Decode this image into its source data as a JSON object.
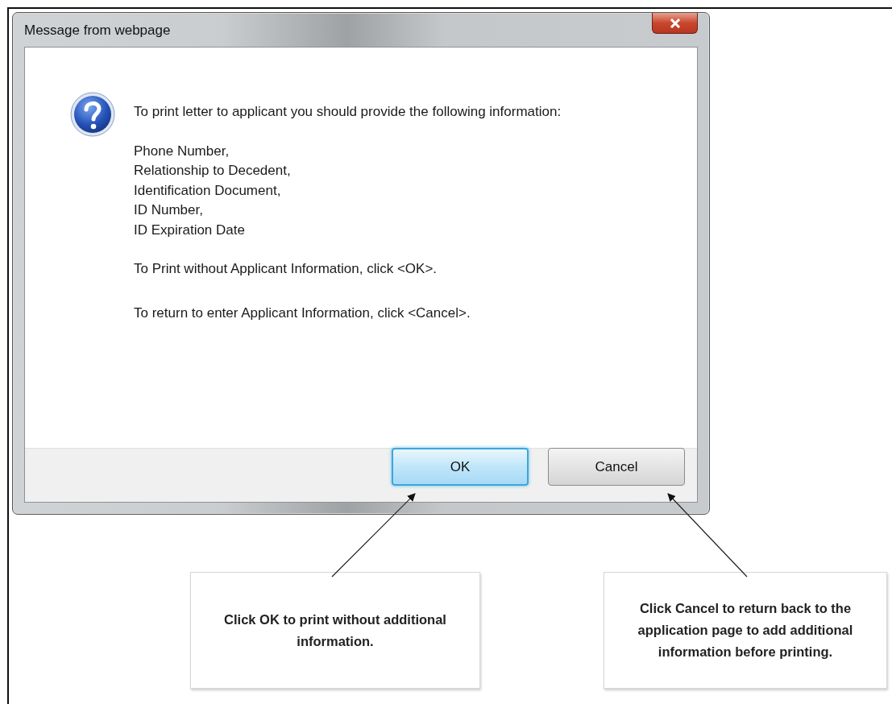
{
  "window": {
    "title": "Message from webpage"
  },
  "message": {
    "intro": "To print letter to applicant you should provide the following information:",
    "items": [
      "Phone Number,",
      "Relationship to Decedent,",
      "Identification Document,",
      "ID Number,",
      "ID Expiration Date"
    ],
    "instructions": [
      "To Print without Applicant Information, click <OK>.",
      "To return to enter Applicant Information, click <Cancel>."
    ]
  },
  "buttons": [
    {
      "label": "OK",
      "default": true
    },
    {
      "label": "Cancel",
      "default": false
    }
  ],
  "callouts": [
    {
      "text": "Click OK to print without additional information."
    },
    {
      "text": "Click Cancel to return back to the application page to add additional information before printing."
    }
  ]
}
